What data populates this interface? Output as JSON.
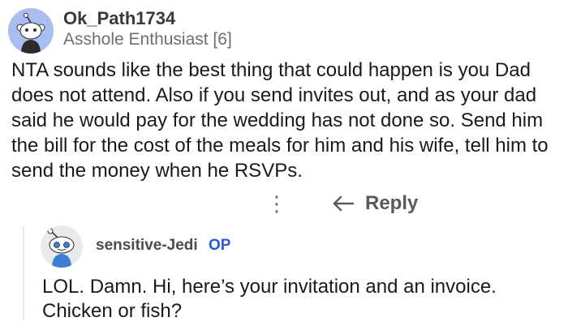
{
  "comment": {
    "username": "Ok_Path1734",
    "flair": "Asshole Enthusiast [6]",
    "body": "NTA sounds like the best thing that could happen is you Dad does not attend. Also if you send invites out, and as your dad said he would pay for the wedding has not done so. Send him the bill for the cost of the meals for him and his wife, tell him to send the money when he RSVPs.",
    "avatar_icon": "snoo-avatar-icon",
    "more_icon": "more-vertical-icon",
    "more_glyph": "⋮",
    "reply_icon": "reply-arrow-icon",
    "reply_label": "Reply"
  },
  "reply": {
    "username": "sensitive-Jedi",
    "op_badge": "OP",
    "body": "LOL. Damn. Hi, here’s your invitation and an invoice. Chicken or fish?",
    "avatar_icon": "snoo-avatar-icon"
  },
  "colors": {
    "op_badge": "#2a5bd7",
    "avatar_main_bg": "#a9bdf0",
    "thread_line": "#e4e5e7"
  }
}
